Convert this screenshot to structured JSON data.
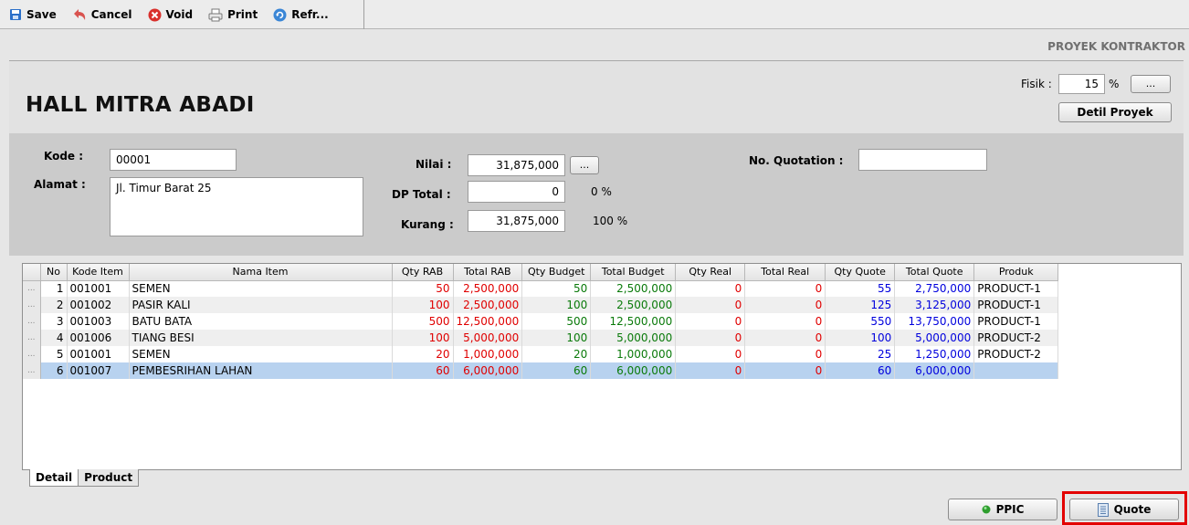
{
  "toolbar": {
    "save": "Save",
    "cancel": "Cancel",
    "void": "Void",
    "print": "Print",
    "refresh": "Refr..."
  },
  "header": {
    "corner_label": "PROYEK KONTRAKTOR",
    "project_name": "HALL MITRA ABADI",
    "fisik_label": "Fisik :",
    "fisik_value": "15",
    "fisik_unit": "%",
    "fisik_browse": "...",
    "detil_button": "Detil Proyek"
  },
  "form": {
    "kode_label": "Kode :",
    "kode_value": "00001",
    "alamat_label": "Alamat :",
    "alamat_value": "Jl. Timur Barat 25",
    "nilai_label": "Nilai :",
    "nilai_value": "31,875,000",
    "nilai_browse": "...",
    "dp_label": "DP Total :",
    "dp_value": "0",
    "dp_pct": "0 %",
    "kurang_label": "Kurang :",
    "kurang_value": "31,875,000",
    "kurang_pct": "100 %",
    "quotation_label": "No. Quotation :",
    "quotation_value": ""
  },
  "grid": {
    "columns": [
      "No",
      "Kode Item",
      "Nama Item",
      "Qty RAB",
      "Total RAB",
      "Qty Budget",
      "Total Budget",
      "Qty Real",
      "Total Real",
      "Qty Quote",
      "Total Quote",
      "Produk"
    ],
    "row_marker": "...",
    "rows": [
      {
        "no": "1",
        "kode": "001001",
        "nama": "SEMEN",
        "qty_rab": "50",
        "total_rab": "2,500,000",
        "qty_budget": "50",
        "total_budget": "2,500,000",
        "qty_real": "0",
        "total_real": "0",
        "qty_quote": "55",
        "total_quote": "2,750,000",
        "produk": "PRODUCT-1"
      },
      {
        "no": "2",
        "kode": "001002",
        "nama": "PASIR KALI",
        "qty_rab": "100",
        "total_rab": "2,500,000",
        "qty_budget": "100",
        "total_budget": "2,500,000",
        "qty_real": "0",
        "total_real": "0",
        "qty_quote": "125",
        "total_quote": "3,125,000",
        "produk": "PRODUCT-1"
      },
      {
        "no": "3",
        "kode": "001003",
        "nama": "BATU BATA",
        "qty_rab": "500",
        "total_rab": "12,500,000",
        "qty_budget": "500",
        "total_budget": "12,500,000",
        "qty_real": "0",
        "total_real": "0",
        "qty_quote": "550",
        "total_quote": "13,750,000",
        "produk": "PRODUCT-1"
      },
      {
        "no": "4",
        "kode": "001006",
        "nama": "TIANG BESI",
        "qty_rab": "100",
        "total_rab": "5,000,000",
        "qty_budget": "100",
        "total_budget": "5,000,000",
        "qty_real": "0",
        "total_real": "0",
        "qty_quote": "100",
        "total_quote": "5,000,000",
        "produk": "PRODUCT-2"
      },
      {
        "no": "5",
        "kode": "001001",
        "nama": "SEMEN",
        "qty_rab": "20",
        "total_rab": "1,000,000",
        "qty_budget": "20",
        "total_budget": "1,000,000",
        "qty_real": "0",
        "total_real": "0",
        "qty_quote": "25",
        "total_quote": "1,250,000",
        "produk": "PRODUCT-2"
      },
      {
        "no": "6",
        "kode": "001007",
        "nama": "PEMBESRIHAN LAHAN",
        "qty_rab": "60",
        "total_rab": "6,000,000",
        "qty_budget": "60",
        "total_budget": "6,000,000",
        "qty_real": "0",
        "total_real": "0",
        "qty_quote": "60",
        "total_quote": "6,000,000",
        "produk": ""
      }
    ],
    "selected_row": 6
  },
  "tabs": [
    "Detail",
    "Product"
  ],
  "buttons": {
    "ppic": "PPIC",
    "quote": "Quote"
  },
  "colors": {
    "rab": "#e00000",
    "budget": "#0a7a0a",
    "real": "#e00000",
    "quote": "#0000dd",
    "highlight": "#e30000",
    "selected_row": "#b8d2ef"
  }
}
